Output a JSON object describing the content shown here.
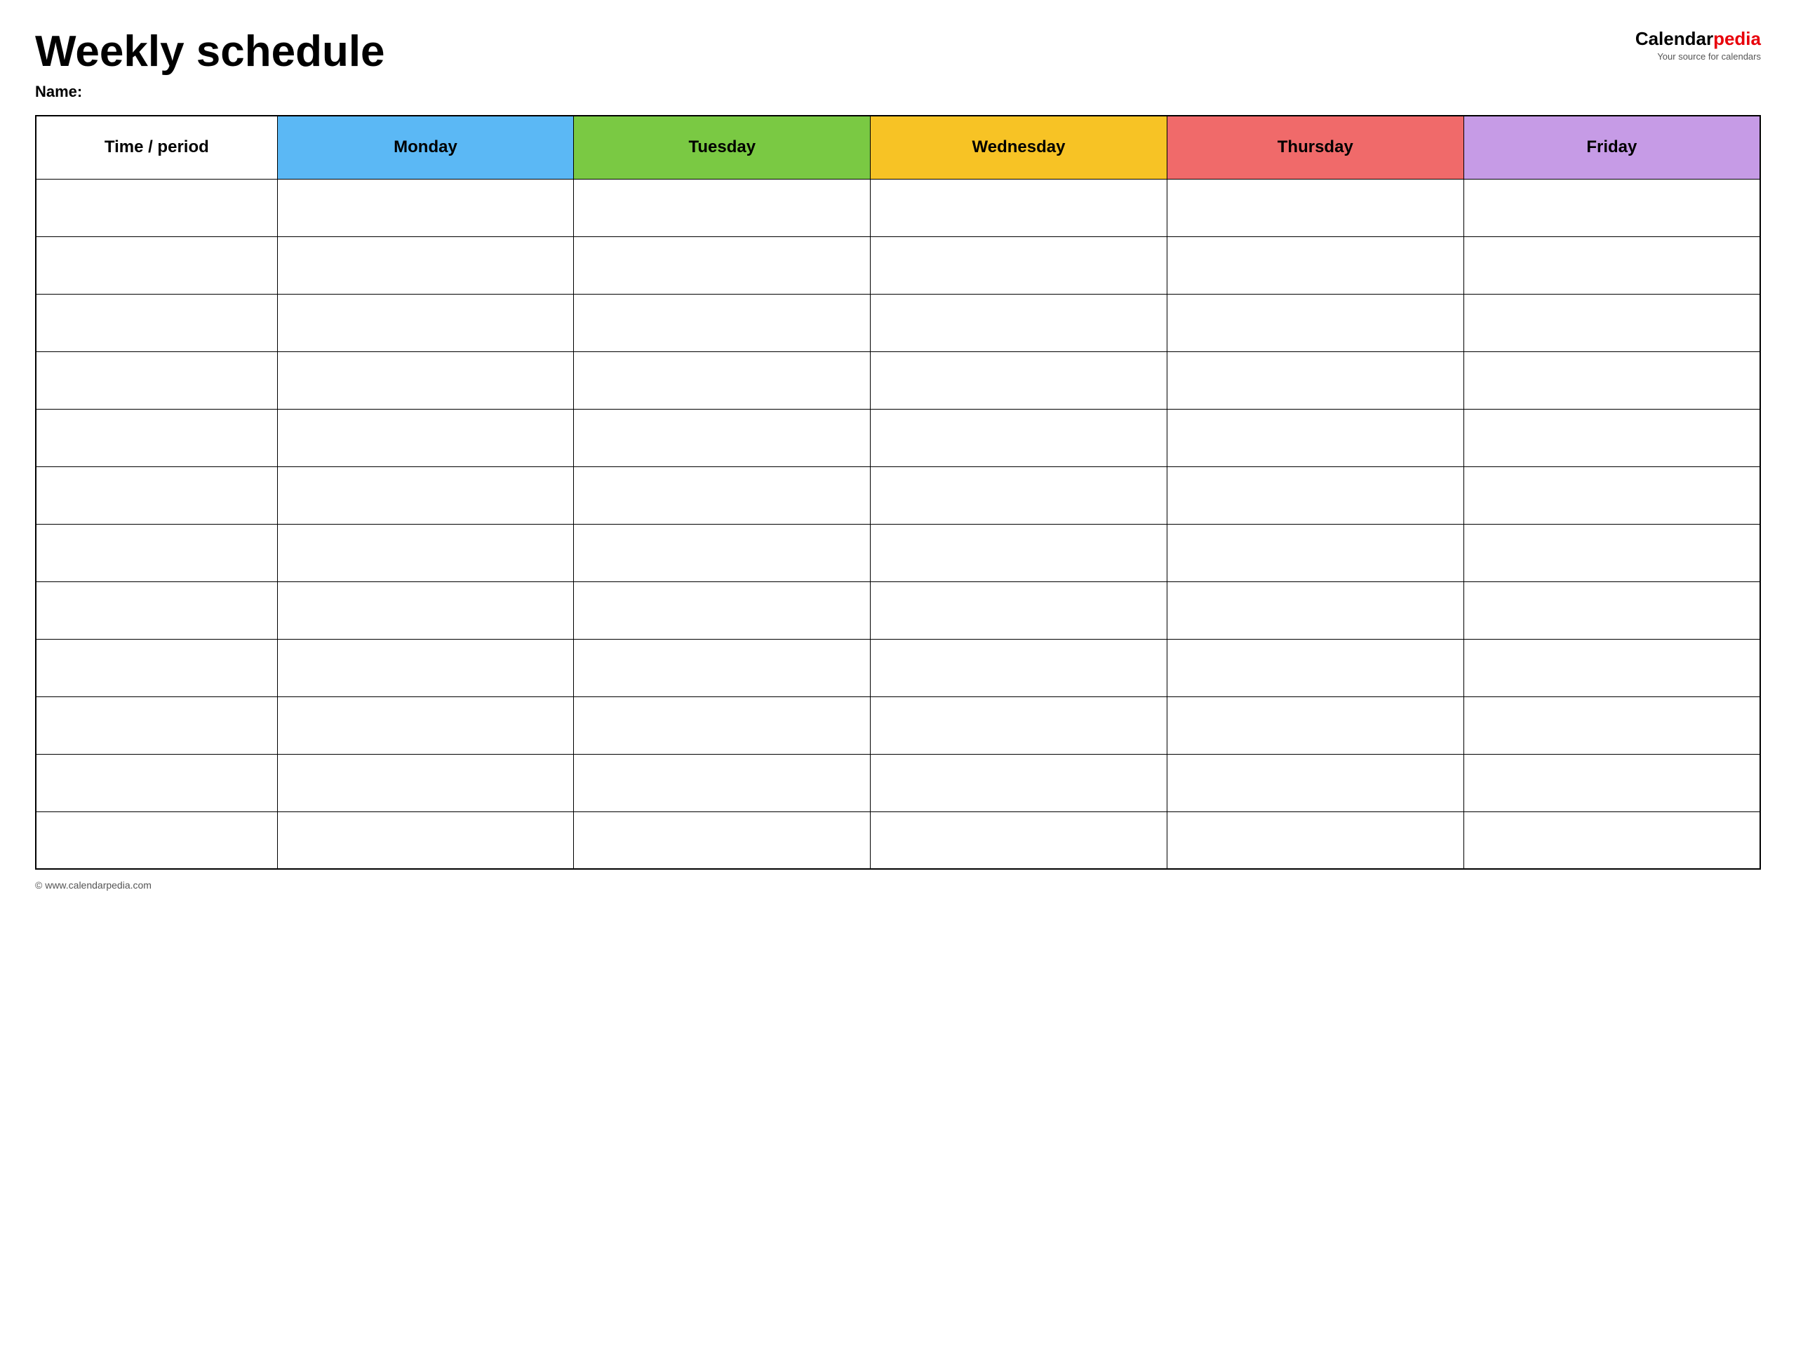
{
  "header": {
    "title": "Weekly schedule",
    "name_label": "Name:",
    "logo_calendar": "Calendar",
    "logo_pedia": "pedia",
    "logo_tagline": "Your source for calendars"
  },
  "table": {
    "columns": [
      {
        "label": "Time / period",
        "class": "th-time"
      },
      {
        "label": "Monday",
        "class": "th-monday"
      },
      {
        "label": "Tuesday",
        "class": "th-tuesday"
      },
      {
        "label": "Wednesday",
        "class": "th-wednesday"
      },
      {
        "label": "Thursday",
        "class": "th-thursday"
      },
      {
        "label": "Friday",
        "class": "th-friday"
      }
    ],
    "row_count": 12
  },
  "footer": {
    "url": "© www.calendarpedia.com"
  }
}
